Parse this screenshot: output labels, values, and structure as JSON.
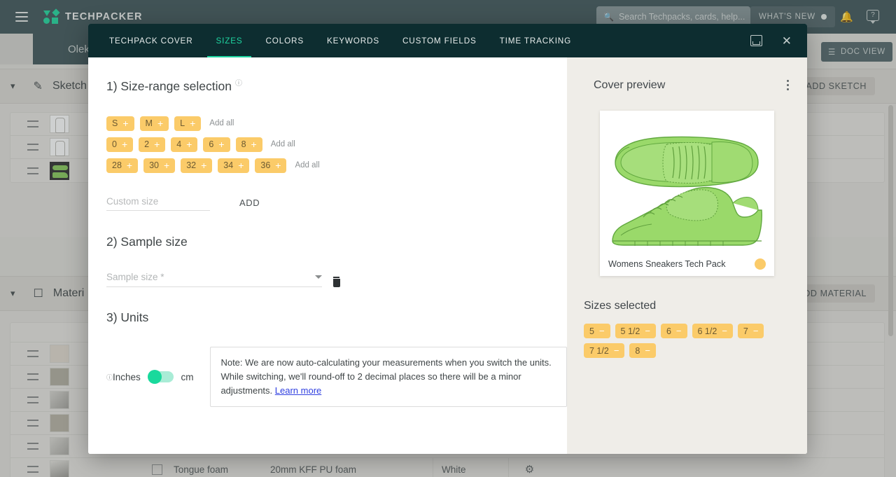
{
  "topbar": {
    "menu_icon": "hamburger-icon",
    "brand": "TECHPACKER",
    "search_placeholder": "Search Techpacks, cards, help...",
    "search_icon": "search-icon",
    "whats_new": "WHAT'S NEW",
    "bell_icon": "bell-icon",
    "help_icon": "help-icon"
  },
  "background": {
    "tab_title": "Oleksan",
    "doc_view": "DOC VIEW",
    "doc_view_icon": "layers-icon",
    "sketch_section": {
      "label": "Sketch",
      "icon": "pencil-icon",
      "chevron": "chevron-down-icon",
      "action": "ADD SKETCH",
      "action_icon": "plus-icon"
    },
    "material_section": {
      "label": "Materi",
      "icon": "cube-icon",
      "chevron": "chevron-down-icon",
      "action": "ADD MATERIAL",
      "action_icon": "plus-icon"
    },
    "material_row": {
      "name": "Tongue foam",
      "description": "20mm KFF PU foam",
      "color": "White",
      "gear_icon": "gear-icon"
    }
  },
  "modal": {
    "tabs": [
      {
        "label": "TECHPACK COVER",
        "active": false
      },
      {
        "label": "SIZES",
        "active": true
      },
      {
        "label": "COLORS",
        "active": false
      },
      {
        "label": "KEYWORDS",
        "active": false
      },
      {
        "label": "CUSTOM FIELDS",
        "active": false
      },
      {
        "label": "TIME TRACKING",
        "active": false
      }
    ],
    "save_icon": "save-icon",
    "close_icon": "close-icon",
    "step1": {
      "title": "1) Size-range selection",
      "info_icon": "info-icon",
      "add_all_label": "Add all",
      "rows": [
        {
          "sizes": [
            "S",
            "M",
            "L"
          ]
        },
        {
          "sizes": [
            "0",
            "2",
            "4",
            "6",
            "8"
          ]
        },
        {
          "sizes": [
            "28",
            "30",
            "32",
            "34",
            "36"
          ]
        }
      ],
      "custom_placeholder": "Custom size",
      "custom_value": "",
      "add_button": "ADD"
    },
    "step2": {
      "title": "2) Sample size",
      "select_placeholder": "Sample size *",
      "select_value": "",
      "caret_icon": "chevron-down-icon",
      "delete_icon": "trash-icon"
    },
    "step3": {
      "title": "3) Units",
      "info_icon": "info-icon",
      "left_label": "Inches",
      "right_label": "cm",
      "toggle_state": "inches",
      "note_text": "Note: We are now auto-calculating your measurements when you switch the units. While switching, we'll round-off to 2 decimal places so there will be a minor adjustments. ",
      "note_link": "Learn more"
    },
    "right": {
      "cover_preview_title": "Cover preview",
      "kebab_icon": "more-vertical-icon",
      "cover_name": "Womens Sneakers Tech Pack",
      "cover_image_alt": "sneaker-illustration",
      "cover_dot_color": "#fbcb69",
      "sizes_selected_title": "Sizes selected",
      "sizes_selected": [
        "5",
        "5 1/2",
        "6",
        "6 1/2",
        "7",
        "7 1/2",
        "8"
      ]
    }
  },
  "colors": {
    "accent_green": "#1fd4a0",
    "chip_yellow": "#fbcb69",
    "modal_header": "#0d2d30",
    "topbar": "#4b5f63",
    "right_pane": "#efede8"
  }
}
